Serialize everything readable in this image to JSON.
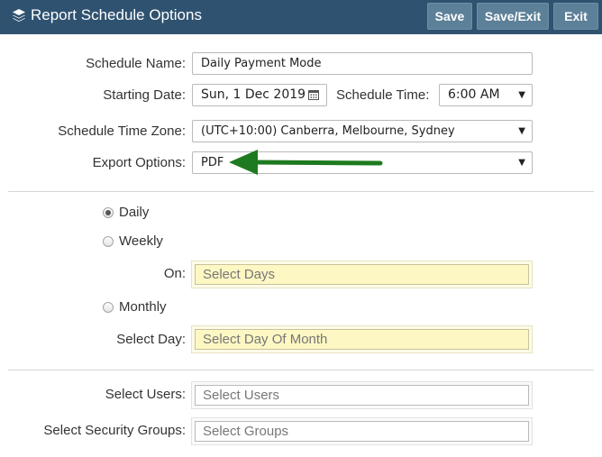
{
  "header": {
    "icon": "layers-icon",
    "title": "Report Schedule Options",
    "buttons": {
      "save": "Save",
      "save_exit": "Save/Exit",
      "exit": "Exit"
    }
  },
  "form": {
    "schedule_name": {
      "label": "Schedule Name:",
      "value": "Daily Payment Mode"
    },
    "starting_date": {
      "label": "Starting Date:",
      "value": "Sun, 1 Dec 2019",
      "icon": "calendar-icon"
    },
    "schedule_time": {
      "label": "Schedule Time:",
      "value": "6:00 AM"
    },
    "time_zone": {
      "label": "Schedule Time Zone:",
      "value": "(UTC+10:00) Canberra, Melbourne, Sydney"
    },
    "export_options": {
      "label": "Export Options:",
      "value": "PDF"
    }
  },
  "annotation": {
    "arrow_color": "#1e7a1e"
  },
  "frequency": {
    "daily": {
      "label": "Daily",
      "checked": true
    },
    "weekly": {
      "label": "Weekly",
      "checked": false
    },
    "on": {
      "label": "On:",
      "placeholder": "Select Days"
    },
    "monthly": {
      "label": "Monthly",
      "checked": false
    },
    "select_day": {
      "label": "Select Day:",
      "placeholder": "Select Day Of Month"
    }
  },
  "recipients": {
    "users": {
      "label": "Select Users:",
      "placeholder": "Select Users"
    },
    "groups": {
      "label": "Select Security Groups:",
      "placeholder": "Select Groups"
    }
  }
}
